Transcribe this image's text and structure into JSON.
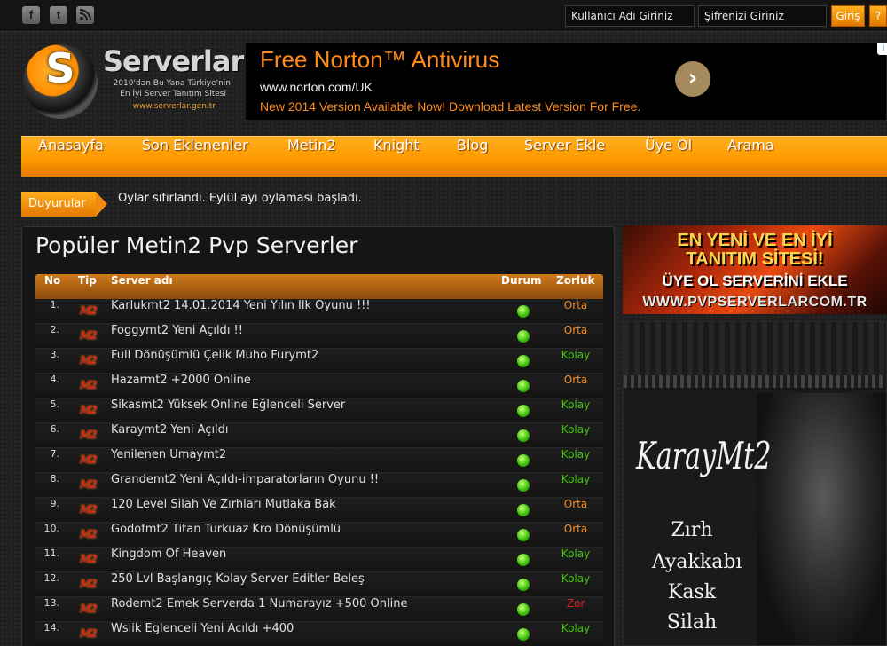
{
  "social": {
    "facebook": "f",
    "twitter": "t",
    "rss": "rss-icon"
  },
  "login": {
    "username_placeholder": "Kullanıcı Adı Giriniz",
    "password_placeholder": "Şifrenizi Giriniz",
    "login_button": "Giriş",
    "help_button": "?"
  },
  "logo": {
    "name": "Serverlar",
    "letter": "S",
    "tagline_1": "2010'dan Bu Yana Türkiye'nin",
    "tagline_2": "En İyi Server Tanıtım Sitesi",
    "url": "www.serverlar.gen.tr"
  },
  "ad": {
    "title": "Free Norton™ Antivirus",
    "url": "www.norton.com/UK",
    "description": "New 2014 Version Available Now! Download Latest Version For Free.",
    "arrow": "›",
    "info": "i"
  },
  "nav": {
    "items": [
      "Anasayfa",
      "Son Eklenenler",
      "Metin2",
      "Knight",
      "Blog",
      "Server Ekle",
      "Üye Ol",
      "Arama"
    ]
  },
  "announcement": {
    "label": "Duyurular",
    "text": "Oylar sıfırlandı. Eylül ayı oylaması başladı."
  },
  "main": {
    "title": "Popüler Metin2 Pvp Serverler",
    "headers": [
      "No",
      "Tip",
      "Server adı",
      "Durum",
      "Zorluk"
    ],
    "rows": [
      {
        "no": "1.",
        "tip": "M2",
        "name": "Karlukmt2 14.01.2014 Yeni Yılın Ilk Oyunu !!!",
        "status": "online",
        "difficulty": "Orta"
      },
      {
        "no": "2.",
        "tip": "M2",
        "name": "Foggymt2 Yeni Açıldı !!",
        "status": "online",
        "difficulty": "Orta"
      },
      {
        "no": "3.",
        "tip": "M2",
        "name": "Full Dönüşümlü Çelik Muho Furymt2",
        "status": "online",
        "difficulty": "Kolay"
      },
      {
        "no": "4.",
        "tip": "M2",
        "name": "Hazarmt2 +2000 Online",
        "status": "online",
        "difficulty": "Orta"
      },
      {
        "no": "5.",
        "tip": "M2",
        "name": "Sikasmt2 Yüksek Online Eğlenceli Server",
        "status": "online",
        "difficulty": "Kolay"
      },
      {
        "no": "6.",
        "tip": "M2",
        "name": "Karaymt2 Yeni Açıldı",
        "status": "online",
        "difficulty": "Kolay"
      },
      {
        "no": "7.",
        "tip": "M2",
        "name": "Yenilenen Umaymt2",
        "status": "online",
        "difficulty": "Kolay"
      },
      {
        "no": "8.",
        "tip": "M2",
        "name": "Grandemt2 Yeni Açıldı-imparatorların Oyunu !!",
        "status": "online",
        "difficulty": "Kolay"
      },
      {
        "no": "9.",
        "tip": "M2",
        "name": "120 Level Silah Ve Zırhları Mutlaka Bak",
        "status": "online",
        "difficulty": "Orta"
      },
      {
        "no": "10.",
        "tip": "M2",
        "name": "Godofmt2 Titan Turkuaz Kro Dönüşümlü",
        "status": "online",
        "difficulty": "Orta"
      },
      {
        "no": "11.",
        "tip": "M2",
        "name": "Kingdom Of Heaven",
        "status": "online",
        "difficulty": "Kolay"
      },
      {
        "no": "12.",
        "tip": "M2",
        "name": "250 Lvl Başlangıç Kolay Server Editler Beleş",
        "status": "online",
        "difficulty": "Kolay"
      },
      {
        "no": "13.",
        "tip": "M2",
        "name": "Rodemt2 Emek Serverda 1 Numarayız +500 Online",
        "status": "online",
        "difficulty": "Zor"
      },
      {
        "no": "14.",
        "tip": "M2",
        "name": "Wslik Eglenceli Yeni Acıldı +400",
        "status": "online",
        "difficulty": "Kolay"
      }
    ]
  },
  "colors": {
    "Orta": "#ff8c1a",
    "Kolay": "#3ec40a",
    "Zor": "#e02020",
    "accent": "#ff9a00"
  },
  "sidebar": {
    "banner1": {
      "line1": "EN YENİ VE EN İYİ",
      "line2": "TANITIM SİTESİ!",
      "line3": "ÜYE OL SERVERİNİ EKLE",
      "line4": "WWW.PVPSERVERLARCOM.TR"
    },
    "banner2": {
      "logo": "KarayMt2",
      "words": [
        "Zırh",
        "Ayakkabı",
        "Kask",
        "Silah"
      ]
    }
  }
}
